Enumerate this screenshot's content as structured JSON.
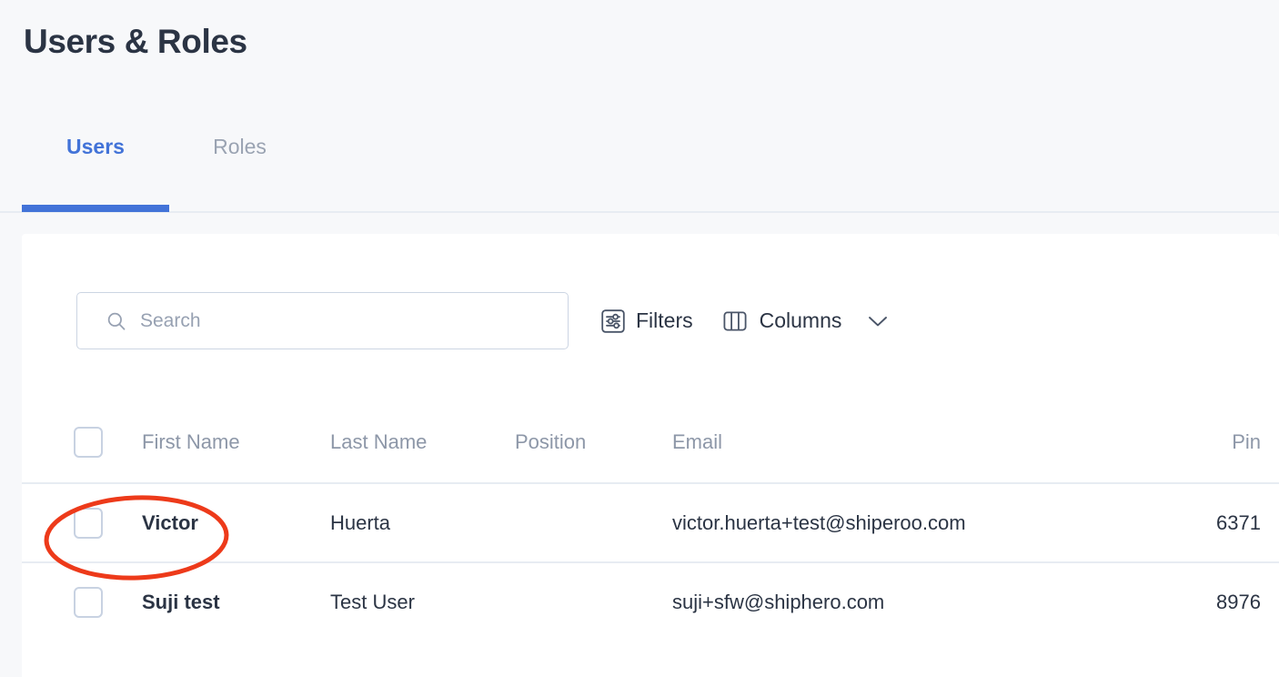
{
  "page": {
    "title": "Users & Roles",
    "background_color": "#f7f8fa"
  },
  "tabs": {
    "active": "Users",
    "accent_color": "#4273d8",
    "items": [
      {
        "label": "Users",
        "active": true
      },
      {
        "label": "Roles",
        "active": false
      }
    ]
  },
  "toolbar": {
    "search": {
      "value": "",
      "placeholder": "Search",
      "icon": "search-icon"
    },
    "filters": {
      "label": "Filters",
      "icon": "filters-icon"
    },
    "columns": {
      "label": "Columns",
      "icon": "columns-icon",
      "chevron": "chevron-down-icon"
    }
  },
  "table": {
    "columns": [
      {
        "key": "select",
        "label": ""
      },
      {
        "key": "first_name",
        "label": "First Name"
      },
      {
        "key": "last_name",
        "label": "Last Name"
      },
      {
        "key": "position",
        "label": "Position"
      },
      {
        "key": "email",
        "label": "Email"
      },
      {
        "key": "pin",
        "label": "Pin"
      }
    ],
    "rows": [
      {
        "first_name": "Victor",
        "last_name": "Huerta",
        "position": "",
        "email": "victor.huerta+test@shiperoo.com",
        "pin": "6371",
        "selected": false
      },
      {
        "first_name": "Suji test",
        "last_name": "Test User",
        "position": "",
        "email": "suji+sfw@shiphero.com",
        "pin": "8976",
        "selected": false
      }
    ]
  },
  "annotation": {
    "shape": "ellipse",
    "color": "#ed3a1a",
    "stroke_width": 5,
    "target": "first-row-checkbox-and-name"
  }
}
